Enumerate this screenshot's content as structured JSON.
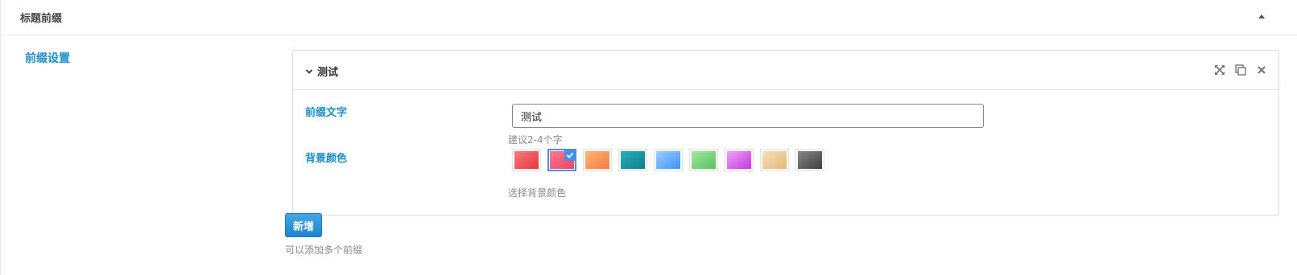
{
  "panel": {
    "title": "标题前缀",
    "collapse_icon": "triangle-up-icon"
  },
  "section": {
    "label": "前缀设置"
  },
  "group": {
    "title": "测试",
    "tools": [
      "expand-icon",
      "duplicate-icon",
      "close-icon"
    ],
    "fields": {
      "prefix_text": {
        "label": "前缀文字",
        "value": "测试",
        "hint": "建议2-4个字"
      },
      "bg_color": {
        "label": "背景颜色",
        "hint": "选择背景颜色",
        "selected_index": 1,
        "swatches": [
          {
            "from": "#f87a7a",
            "to": "#e8363f"
          },
          {
            "from": "#f97a8f",
            "to": "#f04464"
          },
          {
            "from": "#ffb57a",
            "to": "#f97b3c"
          },
          {
            "from": "#25b1b8",
            "to": "#117f8a"
          },
          {
            "from": "#9bd0ff",
            "to": "#3d92f5"
          },
          {
            "from": "#a8e6a0",
            "to": "#55c35a"
          },
          {
            "from": "#f2a0f7",
            "to": "#c538e0"
          },
          {
            "from": "#f8e1bf",
            "to": "#e3b772"
          },
          {
            "from": "#8a8a8a",
            "to": "#3c3c3c"
          }
        ]
      }
    }
  },
  "add_button": {
    "label": "新增",
    "hint": "可以添加多个前缀"
  },
  "colors": {
    "accent": "#1a8ec7",
    "button": "#2b91d9",
    "hint": "#8a8a8a"
  }
}
